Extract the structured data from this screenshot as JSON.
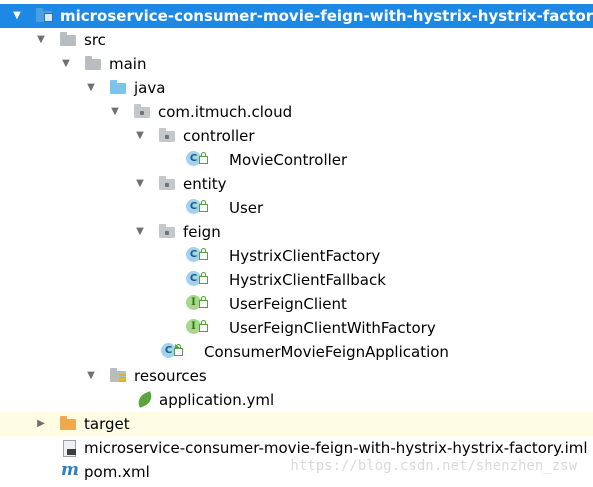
{
  "tree": {
    "items": [
      {
        "label": "microservice-consumer-movie-feign-with-hystrix-hystrix-factory",
        "icon": "module-folder-icon",
        "state": "expanded",
        "selected": true
      },
      {
        "label": "src",
        "icon": "folder-icon",
        "state": "expanded"
      },
      {
        "label": "main",
        "icon": "folder-icon",
        "state": "expanded"
      },
      {
        "label": "java",
        "icon": "source-root-folder-icon",
        "state": "expanded"
      },
      {
        "label": "com.itmuch.cloud",
        "icon": "package-icon",
        "state": "expanded"
      },
      {
        "label": "controller",
        "icon": "package-icon",
        "state": "expanded"
      },
      {
        "label": "MovieController",
        "icon": "class-icon"
      },
      {
        "label": "entity",
        "icon": "package-icon",
        "state": "expanded"
      },
      {
        "label": "User",
        "icon": "class-icon"
      },
      {
        "label": "feign",
        "icon": "package-icon",
        "state": "expanded"
      },
      {
        "label": "HystrixClientFactory",
        "icon": "class-icon"
      },
      {
        "label": "HystrixClientFallback",
        "icon": "class-icon"
      },
      {
        "label": "UserFeignClient",
        "icon": "interface-icon"
      },
      {
        "label": "UserFeignClientWithFactory",
        "icon": "interface-icon"
      },
      {
        "label": "ConsumerMovieFeignApplication",
        "icon": "spring-boot-class-icon"
      },
      {
        "label": "resources",
        "icon": "resources-folder-icon",
        "state": "expanded"
      },
      {
        "label": "application.yml",
        "icon": "spring-leaf-icon"
      },
      {
        "label": "target",
        "icon": "excluded-folder-icon",
        "state": "collapsed"
      },
      {
        "label": "microservice-consumer-movie-feign-with-hystrix-hystrix-factory.iml",
        "icon": "iml-file-icon"
      },
      {
        "label": "pom.xml",
        "icon": "maven-icon"
      }
    ]
  },
  "icons": {
    "class_glyph": "C",
    "interface_glyph": "I",
    "maven_glyph": "m",
    "expanded_glyph": "▼",
    "collapsed_glyph": "▶"
  },
  "colors": {
    "selection": "#1e88e5",
    "highlight_row": "#fefde4",
    "class_badge": "#9fd3ef",
    "interface_badge": "#a7d68f",
    "excluded_folder": "#f0a84c"
  },
  "watermark": "https://blog.csdn.net/shenzhen_zsw"
}
